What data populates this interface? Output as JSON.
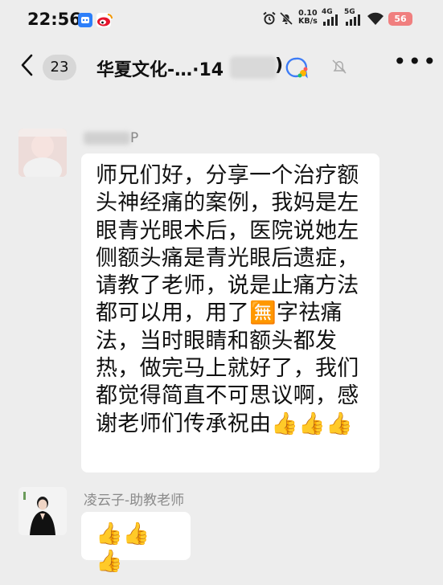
{
  "status_bar": {
    "time": "22:56",
    "speed": "0.10\nKB/s",
    "net1": "4G",
    "net2": "5G",
    "battery": "56"
  },
  "nav": {
    "badge_count": "23",
    "title": "华夏文化-…·14",
    "title_tail": ")"
  },
  "messages": [
    {
      "sender": "P",
      "text": "师兄们好，分享一个治疗额头神经痛的案例，我妈是左眼青光眼术后，医院说她左侧额头痛是青光眼后遗症，请教了老师，说是止痛方法都可以用，用了🈚字祛痛法，当时眼睛和额头都发热，做完马上就好了，我们都觉得简直不可思议啊，感谢老师们传承祝由👍👍👍"
    },
    {
      "sender": "凌云子-助教老师",
      "text": "👍👍👍"
    }
  ],
  "colors": {
    "background": "#ededed",
    "bubble": "#ffffff",
    "battery": "#f07f7f"
  }
}
